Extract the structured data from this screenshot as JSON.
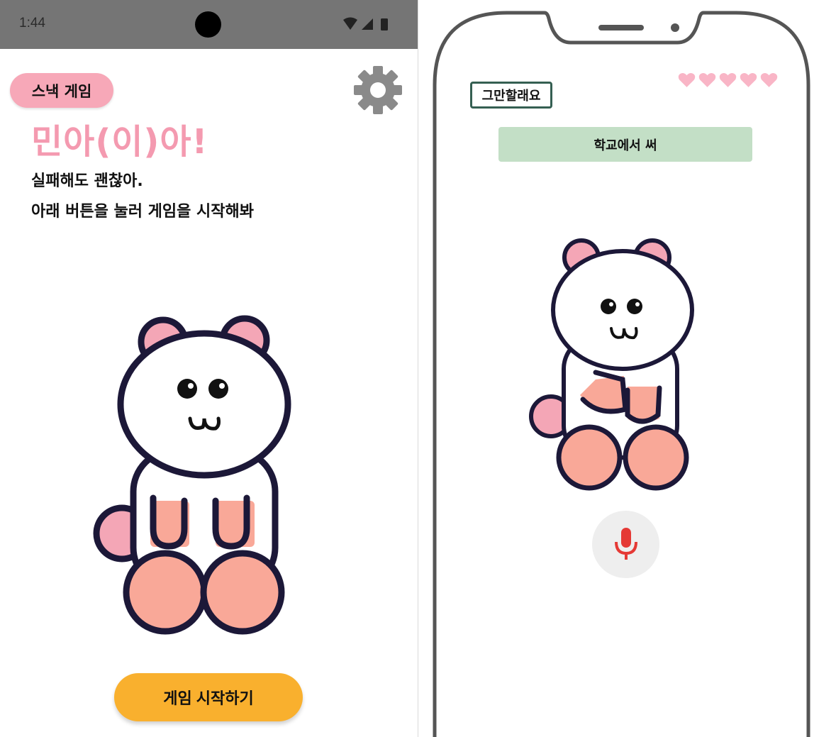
{
  "left_screen": {
    "status_bar": {
      "time": "1:44"
    },
    "chip_label": "스낵 게임",
    "greeting": "민아(이)아!",
    "message_line1": "실패해도 괜찮아.",
    "message_line2": "아래 버튼을 눌러 게임을 시작해봐",
    "start_button_label": "게임 시작하기",
    "icons": [
      "gear-icon",
      "wifi-icon",
      "signal-icon",
      "battery-icon"
    ]
  },
  "right_screen": {
    "stop_button_label": "그만할래요",
    "prompt_text": "학교에서 써",
    "hearts_count": 5,
    "icons": [
      "heart-icon",
      "microphone-icon"
    ]
  },
  "colors": {
    "pink": "#f7a8b8",
    "greeting_pink": "#f49ab0",
    "orange_button": "#f9b02e",
    "prompt_green": "#c3dfc6",
    "bear_outline": "#1c1838",
    "bear_paw": "#f9a898",
    "mic_red": "#e53935"
  }
}
